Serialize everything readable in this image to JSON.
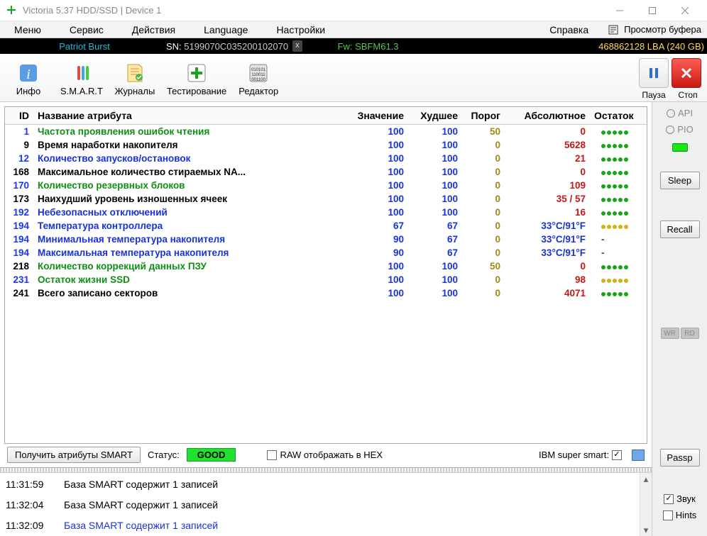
{
  "window": {
    "title": "Victoria 5.37 HDD/SSD | Device 1"
  },
  "menu": {
    "items": [
      "Меню",
      "Сервис",
      "Действия",
      "Language",
      "Настройки",
      "Справка"
    ],
    "right": "Просмотр буфера"
  },
  "info": {
    "model": "Patriot Burst",
    "sn_label": "SN:",
    "sn_value": "5199070C035200102070",
    "fw": "Fw: SBFM61.3",
    "lba": "468862128 LBA (240 GB)"
  },
  "toolbar": {
    "info": "Инфо",
    "smart": "S.M.A.R.T",
    "logs": "Журналы",
    "test": "Тестирование",
    "editor": "Редактор",
    "pause": "Пауза",
    "stop": "Стоп"
  },
  "headers": {
    "id": "ID",
    "name": "Название атрибута",
    "val": "Значение",
    "worst": "Худшее",
    "thr": "Порог",
    "abs": "Абсолютное",
    "rest": "Остаток"
  },
  "rows": [
    {
      "id": "1",
      "id_c": "blue",
      "name": "Частота проявления ошибок чтения",
      "name_c": "green",
      "val": "100",
      "worst": "100",
      "thr": "50",
      "abs": "0",
      "abs_c": "red",
      "rest": "green"
    },
    {
      "id": "9",
      "id_c": "",
      "name": "Время наработки накопителя",
      "name_c": "",
      "val": "100",
      "worst": "100",
      "thr": "0",
      "abs": "5628",
      "abs_c": "red",
      "rest": "green"
    },
    {
      "id": "12",
      "id_c": "blue",
      "name": "Количество запусков/остановок",
      "name_c": "blue",
      "val": "100",
      "worst": "100",
      "thr": "0",
      "abs": "21",
      "abs_c": "red",
      "rest": "green"
    },
    {
      "id": "168",
      "id_c": "",
      "name": "Максимальное количество стираемых NA...",
      "name_c": "",
      "val": "100",
      "worst": "100",
      "thr": "0",
      "abs": "0",
      "abs_c": "red",
      "rest": "green"
    },
    {
      "id": "170",
      "id_c": "blue",
      "name": "Количество резервных блоков",
      "name_c": "green",
      "val": "100",
      "worst": "100",
      "thr": "0",
      "abs": "109",
      "abs_c": "red",
      "rest": "green"
    },
    {
      "id": "173",
      "id_c": "",
      "name": "Наихудший уровень изношенных ячеек",
      "name_c": "",
      "val": "100",
      "worst": "100",
      "thr": "0",
      "abs": "35 / 57",
      "abs_c": "red",
      "rest": "green"
    },
    {
      "id": "192",
      "id_c": "blue",
      "name": "Небезопасных отключений",
      "name_c": "blue",
      "val": "100",
      "worst": "100",
      "thr": "0",
      "abs": "16",
      "abs_c": "red",
      "rest": "green"
    },
    {
      "id": "194",
      "id_c": "blue",
      "name": "Температура контроллера",
      "name_c": "blue",
      "val": "67",
      "worst": "67",
      "thr": "0",
      "abs": "33°C/91°F",
      "abs_c": "blue",
      "rest": "yellow"
    },
    {
      "id": "194",
      "id_c": "blue",
      "name": "Минимальная температура накопителя",
      "name_c": "blue",
      "val": "90",
      "worst": "67",
      "thr": "0",
      "abs": "33°C/91°F",
      "abs_c": "blue",
      "rest": "dash"
    },
    {
      "id": "194",
      "id_c": "blue",
      "name": "Максимальная температура накопителя",
      "name_c": "blue",
      "val": "90",
      "worst": "67",
      "thr": "0",
      "abs": "33°C/91°F",
      "abs_c": "blue",
      "rest": "dash"
    },
    {
      "id": "218",
      "id_c": "",
      "name": "Количество коррекций данных ПЗУ",
      "name_c": "green",
      "val": "100",
      "worst": "100",
      "thr": "50",
      "abs": "0",
      "abs_c": "red",
      "rest": "green"
    },
    {
      "id": "231",
      "id_c": "blue",
      "name": "Остаток жизни SSD",
      "name_c": "green",
      "val": "100",
      "worst": "100",
      "thr": "0",
      "abs": "98",
      "abs_c": "red",
      "rest": "yellow"
    },
    {
      "id": "241",
      "id_c": "",
      "name": "Всего записано секторов",
      "name_c": "",
      "val": "100",
      "worst": "100",
      "thr": "0",
      "abs": "4071",
      "abs_c": "red",
      "rest": "green"
    }
  ],
  "status": {
    "get": "Получить атрибуты SMART",
    "status_label": "Статус:",
    "good": "GOOD",
    "raw_hex": "RAW отображать в HEX",
    "ibm": "IBM super smart:"
  },
  "log": [
    {
      "t": "11:31:59",
      "m": "База SMART содержит 1 записей",
      "c": ""
    },
    {
      "t": "11:32:04",
      "m": "База SMART содержит 1 записей",
      "c": ""
    },
    {
      "t": "11:32:09",
      "m": "База SMART содержит 1 записей",
      "c": "bluerow"
    }
  ],
  "right": {
    "api": "API",
    "pio": "PIO",
    "sleep": "Sleep",
    "recall": "Recall",
    "wr": "WR",
    "rd": "RD",
    "passp": "Passp",
    "sound": "Звук",
    "hints": "Hints"
  }
}
